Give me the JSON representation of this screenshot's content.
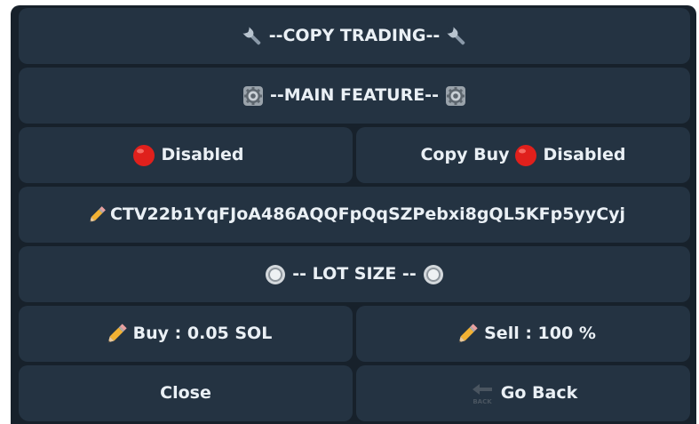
{
  "keyboard": {
    "row1": {
      "label": "--COPY TRADING--",
      "icon": "wrench-icon"
    },
    "row2": {
      "label": "--MAIN FEATURE--",
      "icon": "gear-icon"
    },
    "row3": {
      "left_label": "Disabled",
      "left_icon": "red-circle-icon",
      "right_prefix": "Copy Buy",
      "right_suffix": "Disabled",
      "right_icon": "red-circle-icon"
    },
    "row4": {
      "label": "CTV22b1YqFJoA486AQQFpQqSZPebxi8gQL5KFp5yyCyj",
      "icon": "pencil-icon"
    },
    "row5": {
      "label": "-- LOT SIZE --",
      "icon": "radio-button-icon"
    },
    "row6": {
      "left_label": "Buy : 0.05 SOL",
      "right_label": "Sell : 100 %",
      "icon": "pencil-icon"
    },
    "row7": {
      "left_label": "Close",
      "right_label": "Go Back",
      "right_icon": "back-arrow-icon",
      "back_icon_text": "BACK"
    }
  },
  "colors": {
    "background": "#17212b",
    "button": "#243342",
    "text": "#eaf0f5"
  }
}
